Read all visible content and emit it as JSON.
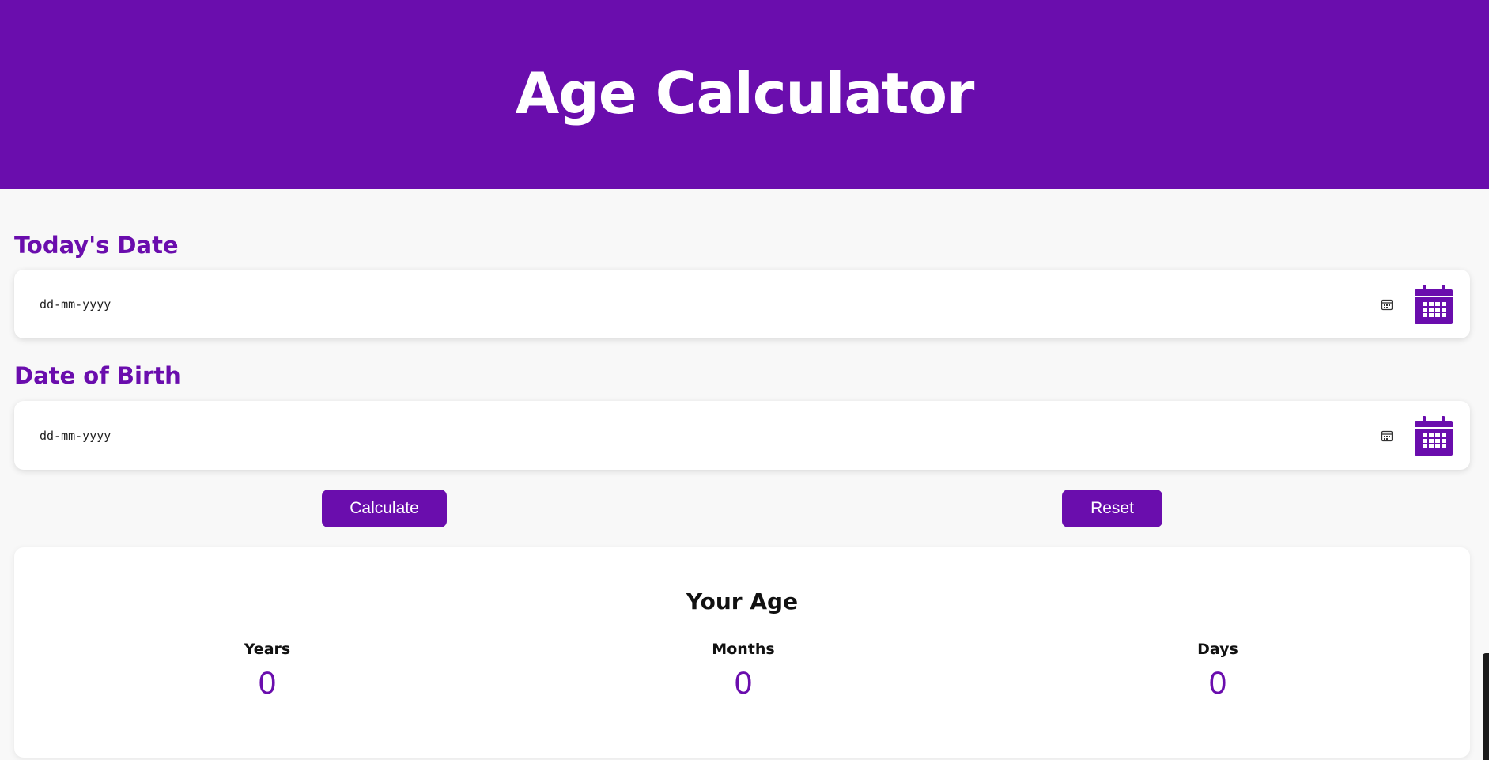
{
  "header": {
    "title": "Age Calculator"
  },
  "colors": {
    "accent": "#6a0dad",
    "background": "#f8f8f8",
    "card": "#ffffff"
  },
  "today": {
    "label": "Today's Date",
    "placeholder": "dd-mm-yyyy",
    "icons": [
      "calendar-picker-icon",
      "calendar-icon"
    ]
  },
  "birth": {
    "label": "Date of Birth",
    "placeholder": "dd-mm-yyyy",
    "icons": [
      "calendar-picker-icon",
      "calendar-icon"
    ]
  },
  "actions": {
    "calculate": "Calculate",
    "reset": "Reset"
  },
  "result": {
    "title": "Your Age",
    "years_label": "Years",
    "years": "0",
    "months_label": "Months",
    "months": "0",
    "days_label": "Days",
    "days": "0"
  }
}
